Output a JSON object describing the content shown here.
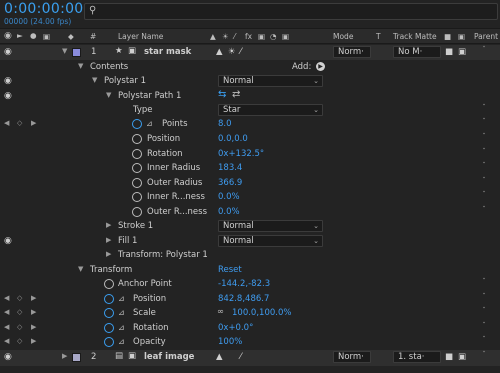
{
  "header": {
    "timecode": "0:00:00:00",
    "frames_fps": "00000 (24.00 fps)",
    "search_placeholder": "",
    "columns": {
      "hash": "#",
      "layer_name": "Layer Name",
      "mode": "Mode",
      "t": "T",
      "track_matte": "Track Matte",
      "parent": "Parent"
    }
  },
  "layers": [
    {
      "index": "1",
      "name": "star mask",
      "mode": "Norm·",
      "matte": "No M·",
      "label_color": "#8a8cdc"
    },
    {
      "index": "2",
      "name": "leaf image",
      "mode": "Norm·",
      "matte": "1. sta·",
      "label_color": "#a9a9c8"
    }
  ],
  "contents": {
    "label": "Contents",
    "add_label": "Add:",
    "polystar": {
      "label": "Polystar 1",
      "mode": "Normal"
    },
    "path": {
      "label": "Polystar Path 1",
      "type_label": "Type",
      "type_value": "Star",
      "props": [
        {
          "name": "Points",
          "value": "8.0"
        },
        {
          "name": "Position",
          "value": "0.0,0.0"
        },
        {
          "name": "Rotation",
          "value": "0x+132.5°"
        },
        {
          "name": "Inner Radius",
          "value": "183.4"
        },
        {
          "name": "Outer Radius",
          "value": "366.9"
        },
        {
          "name": "Inner R...ness",
          "value": "0.0%"
        },
        {
          "name": "Outer R...ness",
          "value": "0.0%"
        }
      ]
    },
    "stroke": {
      "label": "Stroke 1",
      "mode": "Normal"
    },
    "fill": {
      "label": "Fill 1",
      "mode": "Normal"
    },
    "transform_poly": {
      "label": "Transform: Polystar 1"
    }
  },
  "transform": {
    "label": "Transform",
    "reset_label": "Reset",
    "props": [
      {
        "name": "Anchor Point",
        "value": "-144.2,-82.3"
      },
      {
        "name": "Position",
        "value": "842.8,486.7"
      },
      {
        "name": "Scale",
        "value": "100.0,100.0%"
      },
      {
        "name": "Rotation",
        "value": "0x+0.0°"
      },
      {
        "name": "Opacity",
        "value": "100%"
      }
    ]
  },
  "colors": {
    "accent_blue": "#3f9cf0",
    "background": "#232323"
  },
  "icons": [
    "eye-icon",
    "lock-icon",
    "search-icon",
    "star-icon",
    "stopwatch-icon",
    "graph-icon",
    "swirl-icon",
    "fx-icon",
    "chevron-down-icon"
  ]
}
